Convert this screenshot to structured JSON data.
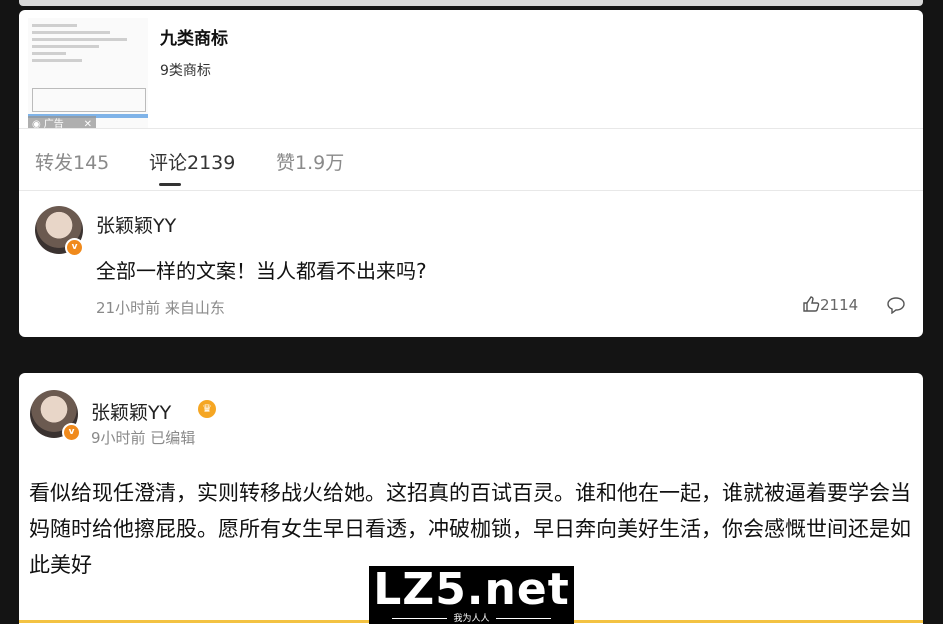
{
  "ad": {
    "tag_label": "广告",
    "title": "九类商标",
    "subtitle": "9类商标"
  },
  "tabs": [
    {
      "label": "转发145"
    },
    {
      "label": "评论2139"
    },
    {
      "label": "赞1.9万"
    }
  ],
  "comment1": {
    "username": "张颖颖YY",
    "text": "全部一样的文案！当人都看不出来吗?",
    "meta": "21小时前 来自山东",
    "likes": "2114"
  },
  "post2": {
    "username": "张颖颖YY",
    "meta": "9小时前 已编辑",
    "body": "看似给现任澄清，实则转移战火给她。这招真的百试百灵。谁和他在一起，谁就被逼着要学会当妈随时给他擦屁股。愿所有女生早日看透，冲破枷锁，早日奔向美好生活，你会感慨世间还是如此美好"
  },
  "watermark": {
    "main": "LZ5.net",
    "sub": "我为人人"
  },
  "colors": {
    "verified_badge": "#f08a1c",
    "accent_line": "#f3c242"
  }
}
